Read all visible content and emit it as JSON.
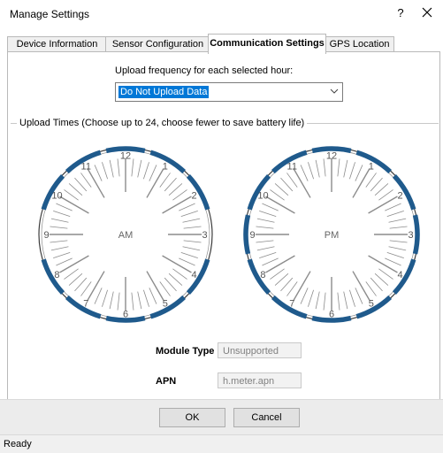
{
  "window": {
    "title": "Manage Settings",
    "help_glyph": "?"
  },
  "tabs": [
    {
      "label": "Device Information",
      "active": false
    },
    {
      "label": "Sensor Configuration",
      "active": false
    },
    {
      "label": "Communication Settings",
      "active": true
    },
    {
      "label": "GPS Location",
      "active": false
    }
  ],
  "upload": {
    "frequency_label": "Upload frequency for each selected hour:",
    "frequency_value": "Do Not Upload Data",
    "times_label": "Upload Times (Choose up to 24, choose fewer to save battery life)"
  },
  "clocks": [
    {
      "label": "AM",
      "hours": [
        "12",
        "1",
        "2",
        "3",
        "4",
        "5",
        "6",
        "7",
        "8",
        "9",
        "10",
        "11"
      ],
      "selected": [
        true,
        true,
        true,
        false,
        true,
        true,
        true,
        true,
        true,
        false,
        true,
        true
      ]
    },
    {
      "label": "PM",
      "hours": [
        "12",
        "1",
        "2",
        "3",
        "4",
        "5",
        "6",
        "7",
        "8",
        "9",
        "10",
        "11"
      ],
      "selected": [
        true,
        true,
        true,
        true,
        true,
        true,
        true,
        true,
        true,
        true,
        true,
        true
      ]
    }
  ],
  "module": {
    "type_label": "Module Type",
    "type_value": "Unsupported",
    "apn_label": "APN",
    "apn_value": "h.meter.apn"
  },
  "buttons": {
    "ok": "OK",
    "cancel": "Cancel"
  },
  "status": {
    "text": "Ready"
  },
  "colors": {
    "selected_arc": "#1f5a8c",
    "tick": "#8c8c8c",
    "highlight": "#0078d7"
  }
}
